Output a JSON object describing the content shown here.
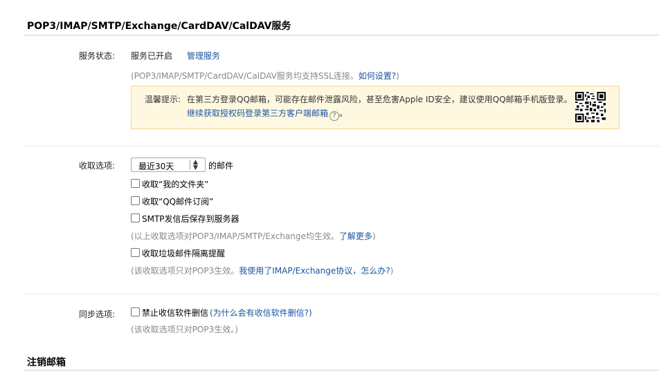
{
  "header": {
    "title": "POP3/IMAP/SMTP/Exchange/CardDAV/CalDAV服务"
  },
  "service": {
    "label": "服务状态:",
    "status": "服务已开启",
    "manage_link": "管理服务",
    "note_prefix": "(POP3/IMAP/SMTP/CardDAV/CalDAV服务均支持SSL连接。",
    "note_link": "如何设置?",
    "note_suffix": ")",
    "tip_label": "温馨提示:",
    "tip_line1": "在第三方登录QQ邮箱，可能存在邮件泄露风险，甚至危害Apple ID安全，建议使用QQ邮箱手机版登录。",
    "tip_line2": "继续获取授权码登录第三方客户端邮箱",
    "help_glyph": "?"
  },
  "fetch": {
    "label": "收取选项:",
    "select_value": "最近30天",
    "select_suffix": "的邮件",
    "opt1": "收取“我的文件夹”",
    "opt2": "收取“QQ邮件订阅”",
    "opt3": "SMTP发信后保存到服务器",
    "note1_prefix": "(以上收取选项对POP3/IMAP/SMTP/Exchange均生效。",
    "note1_link": "了解更多",
    "note1_suffix": ")",
    "opt4": "收取垃圾邮件隔离提醒",
    "note2_prefix": "(该收取选项只对POP3生效。",
    "note2_link": "我使用了IMAP/Exchange协议，怎么办?",
    "note2_suffix": ")"
  },
  "sync": {
    "label": "同步选项:",
    "opt1": "禁止收信软件删信",
    "opt1_link": "(为什么会有收信软件删信?)",
    "note": "(该收取选项只对POP3生效。)"
  },
  "cancel": {
    "title": "注销邮箱"
  }
}
